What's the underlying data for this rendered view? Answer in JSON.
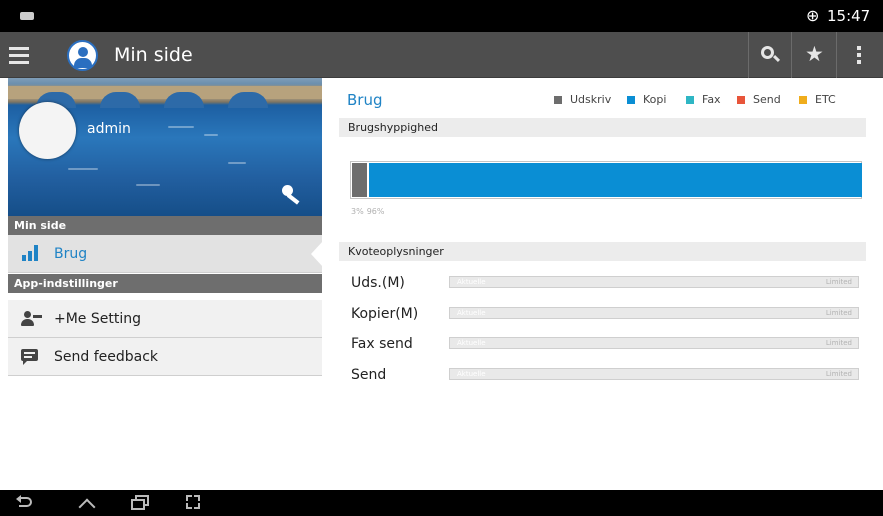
{
  "status_bar": {
    "time": "15:47",
    "globe_glyph": "⊕"
  },
  "action_bar": {
    "title": "Min side",
    "icons": [
      "menu-icon",
      "user-avatar-icon",
      "search-icon",
      "star-icon",
      "overflow-menu-icon"
    ],
    "star_glyph": "★"
  },
  "profile": {
    "username": "admin",
    "key_icon": "key-icon"
  },
  "sidebar": {
    "section_my_page": "Min side",
    "usage_item": "Brug",
    "section_app_settings": "App-indstillinger",
    "items": [
      {
        "label": "+Me Setting",
        "icon": "person-settings-icon"
      },
      {
        "label": "Send feedback",
        "icon": "feedback-icon"
      }
    ]
  },
  "usage": {
    "title": "Brug",
    "legend": [
      {
        "label": "Udskriv",
        "color": "#6d6d6d"
      },
      {
        "label": "Kopi",
        "color": "#0a8ed4"
      },
      {
        "label": "Fax",
        "color": "#2fb6c4"
      },
      {
        "label": "Send",
        "color": "#e8553a"
      },
      {
        "label": "ETC",
        "color": "#f0ad1c"
      }
    ],
    "frequency_header": "Brugshyppighed",
    "print_percent": 3,
    "copy_percent": 96,
    "percent_labels": [
      "3%",
      "96%"
    ]
  },
  "quota": {
    "header": "Kvoteoplysninger",
    "rows": [
      {
        "label": "Uds.(M)",
        "current": "Aktuelle",
        "limit": "Limited"
      },
      {
        "label": "Kopier(M)",
        "current": "Aktuelle",
        "limit": "Limited"
      },
      {
        "label": "Fax send",
        "current": "Aktuelle",
        "limit": "Limited"
      },
      {
        "label": "Send",
        "current": "Aktuelle",
        "limit": "Limited"
      }
    ]
  },
  "colors": {
    "accent": "#1f83c5",
    "action_bar": "#4e4e4e",
    "section_header": "#6e6e6e"
  }
}
